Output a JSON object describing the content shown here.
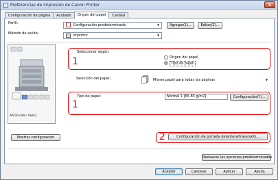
{
  "window": {
    "title": "Preferencias de impresión de Canon Printer",
    "close": "X"
  },
  "tabs": [
    {
      "label": "Configuración de página"
    },
    {
      "label": "Acabado"
    },
    {
      "label": "Origen del papel"
    },
    {
      "label": "Calidad"
    }
  ],
  "profile": {
    "label": "Perfil:",
    "value": "Configuración predeterminada",
    "add_button": "Agregar(1)...",
    "edit_button": "Editar(Z)..."
  },
  "output_method": {
    "label": "Método de salida:",
    "value": "Imprimir"
  },
  "preview": {
    "caption": "A4 [Escala: Auto]"
  },
  "selection": {
    "label": "Seleccionar según:",
    "options": [
      {
        "label": "Origen del papel",
        "selected": false
      },
      {
        "label": "Tipo de papel",
        "selected": true
      }
    ]
  },
  "paper_selection": {
    "label": "Selección del papel:",
    "value": "Mismo papel para todas las páginas"
  },
  "paper_type": {
    "label": "Tipo de papel:",
    "value": "Normal 1 [65-83 g/m2]",
    "config_button": "Configuración(Y)..."
  },
  "cover_button": "Configuración de portada delantera/trasera(K)...",
  "show_settings_button": "Mostrar configuración",
  "restore_defaults_button": "Restaurar las opciones predeterminadas",
  "footer": {
    "accept": "Aceptar",
    "cancel": "Cancelar",
    "apply": "Aplicar",
    "help": "Ayuda"
  },
  "annotations": {
    "callout_1a": "1",
    "callout_1b": "1",
    "callout_2": "2",
    "color": "#e20000"
  }
}
